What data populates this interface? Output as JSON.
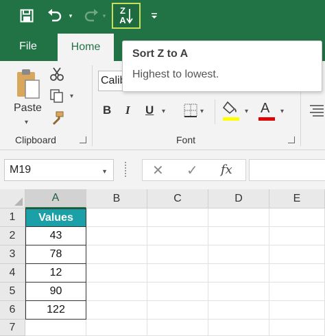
{
  "colors": {
    "ribbon_green": "#217346",
    "header_teal": "#1aa0a6",
    "font_color_red": "#e00000",
    "highlight_yellow": "#ffff00"
  },
  "qat": {
    "save_icon": "save-icon",
    "undo_icon": "undo-icon",
    "redo_icon": "redo-icon",
    "sort_icon": "sort-z-to-a-icon",
    "sort_glyph_top": "Z",
    "sort_glyph_bottom": "A",
    "customize_icon": "customize-qat-icon"
  },
  "tabs": [
    {
      "label": "File",
      "active": false
    },
    {
      "label": "Home",
      "active": true
    }
  ],
  "ribbon": {
    "clipboard": {
      "label": "Clipboard",
      "paste_label": "Paste"
    },
    "font": {
      "label": "Font",
      "font_name": "Calib",
      "bold": "B",
      "italic": "I",
      "underline": "U",
      "font_color_glyph": "A"
    }
  },
  "tooltip": {
    "title": "Sort Z to A",
    "description": "Highest to lowest."
  },
  "formula_bar": {
    "name_box": "M19",
    "fx": "fx",
    "cancel_glyph": "✕",
    "enter_glyph": "✓"
  },
  "sheet": {
    "columns": [
      "A",
      "B",
      "C",
      "D",
      "E"
    ],
    "rows": [
      "1",
      "2",
      "3",
      "4",
      "5",
      "6",
      "7"
    ],
    "header": "Values",
    "values": [
      "43",
      "78",
      "12",
      "90",
      "122"
    ]
  }
}
